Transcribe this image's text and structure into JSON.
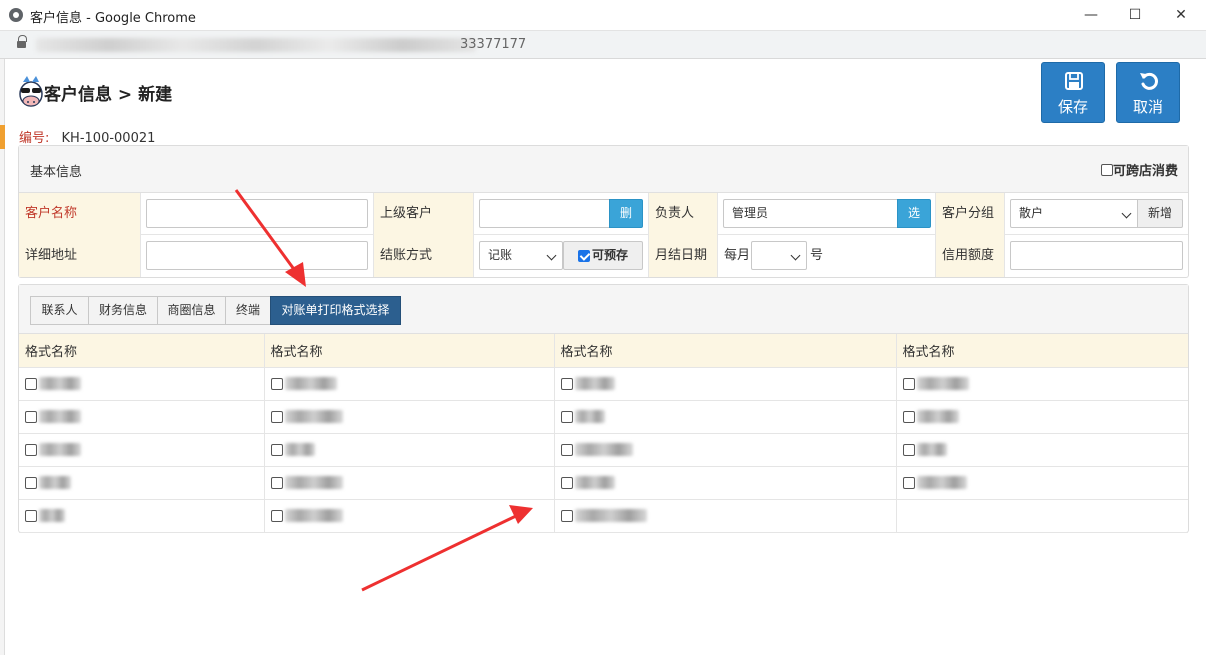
{
  "window": {
    "title": "客户信息 - Google Chrome",
    "url_visible_tail": "33377177",
    "minimize_glyph": "—",
    "maximize_glyph": "☐",
    "close_glyph": "✕"
  },
  "header": {
    "title": "客户信息 > 新建",
    "code_label": "编号:",
    "code_value": "KH-100-00021",
    "save_label": "保存",
    "cancel_label": "取消"
  },
  "basic_panel": {
    "title": "基本信息",
    "cross_store_label": "可跨店消费",
    "cross_store_checked": false,
    "rows": [
      {
        "customer_name_label": "客户名称",
        "customer_name_value": "",
        "parent_customer_label": "上级客户",
        "parent_customer_value": "",
        "parent_delete_button": "删",
        "owner_label": "负责人",
        "owner_value": "管理员",
        "owner_select_button": "选",
        "group_label": "客户分组",
        "group_value": "散户",
        "group_add_button": "新增"
      },
      {
        "address_label": "详细地址",
        "address_value": "",
        "settlement_label": "结账方式",
        "settlement_value": "记账",
        "prepay_label": "可预存",
        "prepay_checked": true,
        "monthly_date_label": "月结日期",
        "monthly_prefix": "每月",
        "monthly_day_value": "",
        "monthly_suffix": "号",
        "credit_label": "信用额度",
        "credit_value": ""
      }
    ]
  },
  "tabs": [
    {
      "label": "联系人",
      "active": false
    },
    {
      "label": "财务信息",
      "active": false
    },
    {
      "label": "商圈信息",
      "active": false
    },
    {
      "label": "终端",
      "active": false
    },
    {
      "label": "对账单打印格式选择",
      "active": true
    }
  ],
  "format_table": {
    "headers": [
      "格式名称",
      "格式名称",
      "格式名称",
      "格式名称"
    ],
    "rows": [
      [
        true,
        true,
        true,
        true
      ],
      [
        true,
        true,
        true,
        true
      ],
      [
        true,
        true,
        true,
        true
      ],
      [
        true,
        true,
        true,
        true
      ],
      [
        true,
        true,
        true,
        false
      ]
    ]
  },
  "colors": {
    "primary_button": "#2c7fc5",
    "active_tab": "#2c5f8f",
    "label_bg": "#fcf6e3",
    "required_label": "#c0392b",
    "annotation_arrow": "#ee3030"
  }
}
